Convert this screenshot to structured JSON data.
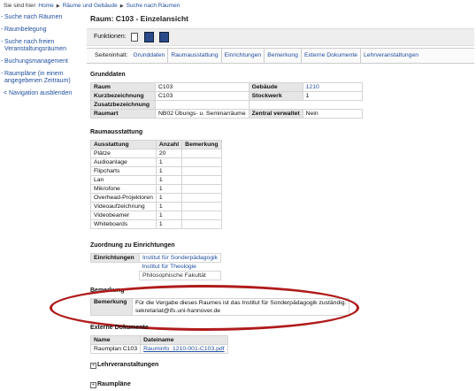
{
  "breadcrumb": {
    "prefix": "Sie sind hier:",
    "items": [
      "Home",
      "Räume und Gebäude",
      "Suche nach Räumen"
    ]
  },
  "sidebar": {
    "items": [
      {
        "label": "Suche nach Räumen"
      },
      {
        "label": "Raumbelegung"
      },
      {
        "label": "Suche nach freien Veranstaltungsräumen"
      },
      {
        "label": "Buchungsmanagement"
      },
      {
        "label": "Raumpläne (in einem angegebenen Zeitraum)"
      }
    ],
    "hide_label": "Navigation ausblenden"
  },
  "page": {
    "title": "Raum: C103 - Einzelansicht"
  },
  "functions": {
    "label": "Funktionen:"
  },
  "tabs": {
    "caption": "Seiteninhalt:",
    "items": [
      "Grunddaten",
      "Raumausstattung",
      "Einrichtungen",
      "Bemerkung",
      "Externe Dokumente",
      "Lehrveranstaltungen"
    ]
  },
  "grunddaten": {
    "heading": "Grunddaten",
    "raum_label": "Raum",
    "raum_value": "C103",
    "gebaeude_label": "Gebäude",
    "gebaeude_value": "1210",
    "kurz_label": "Kurzbezeichnung",
    "kurz_value": "C103",
    "stockwerk_label": "Stockwerk",
    "stockwerk_value": "1",
    "zusatz_label": "Zusatzbezeichnung",
    "zusatz_value": "",
    "raumart_label": "Raumart",
    "raumart_value": "NB02 Übungs- u. Seminarräume",
    "zentral_label": "Zentral verwaltet",
    "zentral_value": "Nein"
  },
  "ausstattung": {
    "heading": "Raumausstattung",
    "headers": [
      "Ausstattung",
      "Anzahl",
      "Bemerkung"
    ],
    "rows": [
      [
        "Plätze",
        "20",
        ""
      ],
      [
        "Audioanlage",
        "1",
        ""
      ],
      [
        "Flipcharts",
        "1",
        ""
      ],
      [
        "Lan",
        "1",
        ""
      ],
      [
        "Mikrofone",
        "1",
        ""
      ],
      [
        "Overhead-Projektoren",
        "1",
        ""
      ],
      [
        "Videoaufzeichnung",
        "1",
        ""
      ],
      [
        "Videobeamer",
        "1",
        ""
      ],
      [
        "Whiteboards",
        "1",
        ""
      ]
    ]
  },
  "einrichtungen": {
    "heading": "Zuordnung zu Einrichtungen",
    "label": "Einrichtungen",
    "items": [
      "Institut für Sonderpädagogik",
      "Institut für Theologie",
      "Philosophische Fakultät"
    ]
  },
  "bemerkung": {
    "heading": "Bemerkung",
    "label": "Bemerkung",
    "line1": "Für die Vergabe dieses Raumes ist das Institut für Sonderpädagogik zuständig.",
    "line2": "sekretariat@ifs.uni-hannover.de"
  },
  "externe": {
    "heading": "Externe Dokumente",
    "headers": [
      "Name",
      "Dateiname"
    ],
    "row": [
      "Raumplan C103",
      "Rauminfo_1210-001-C103.pdf"
    ]
  },
  "collapsed": {
    "lehr": "Lehrveranstaltungen",
    "plaene": "Raumpläne"
  }
}
